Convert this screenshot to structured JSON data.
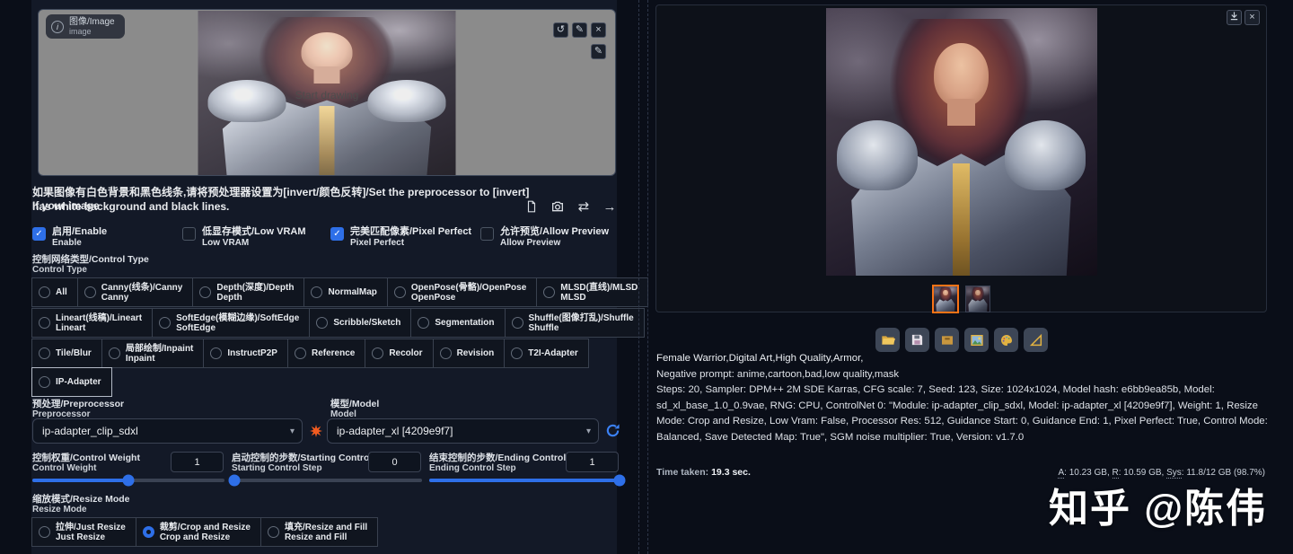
{
  "icons": {
    "caret": "▾",
    "check": "✓",
    "undo": "↺",
    "edit": "✎",
    "close": "×",
    "swap": "⇄",
    "arrow_right": "→",
    "info": "i"
  },
  "left": {
    "image_panel": {
      "label_line1": "图像/Image",
      "label_line2": "image",
      "start_drawing": "Start drawing"
    },
    "hint_line1": "如果图像有白色背景和黑色线条,请将预处理器设置为[invert/颜色反转]/Set the preprocessor to [invert] If your image",
    "hint_line2": "has white background and black lines.",
    "checkboxes": [
      {
        "l1": "启用/Enable",
        "l2": "Enable",
        "checked": true
      },
      {
        "l1": "低显存模式/Low VRAM",
        "l2": "Low VRAM",
        "checked": false
      },
      {
        "l1": "完美匹配像素/Pixel Perfect",
        "l2": "Pixel Perfect",
        "checked": true
      },
      {
        "l1": "允许预览/Allow Preview",
        "l2": "Allow Preview",
        "checked": false
      }
    ],
    "control_type_label1": "控制网络类型/Control Type",
    "control_type_label2": "Control Type",
    "control_types": {
      "row1": [
        {
          "l1": "All"
        },
        {
          "l1": "Canny(线条)/Canny",
          "l2": "Canny"
        },
        {
          "l1": "Depth(深度)/Depth",
          "l2": "Depth"
        },
        {
          "l1": "NormalMap"
        },
        {
          "l1": "OpenPose(骨骼)/OpenPose",
          "l2": "OpenPose"
        },
        {
          "l1": "MLSD(直线)/MLSD",
          "l2": "MLSD"
        }
      ],
      "row2": [
        {
          "l1": "Lineart(线稿)/Lineart",
          "l2": "Lineart"
        },
        {
          "l1": "SoftEdge(模糊边缘)/SoftEdge",
          "l2": "SoftEdge"
        },
        {
          "l1": "Scribble/Sketch"
        },
        {
          "l1": "Segmentation"
        },
        {
          "l1": "Shuffle(图像打乱)/Shuffle",
          "l2": "Shuffle"
        }
      ],
      "row3": [
        {
          "l1": "Tile/Blur"
        },
        {
          "l1": "局部绘制/Inpaint",
          "l2": "Inpaint"
        },
        {
          "l1": "InstructP2P"
        },
        {
          "l1": "Reference"
        },
        {
          "l1": "Recolor"
        },
        {
          "l1": "Revision"
        },
        {
          "l1": "T2I-Adapter"
        }
      ],
      "row4": [
        {
          "l1": "IP-Adapter",
          "selected": true
        }
      ]
    },
    "preprocessor": {
      "label1": "预处理/Preprocessor",
      "label2": "Preprocessor",
      "value": "ip-adapter_clip_sdxl"
    },
    "model": {
      "label1": "模型/Model",
      "label2": "Model",
      "value": "ip-adapter_xl [4209e9f7]"
    },
    "sliders": [
      {
        "l1": "控制权重/Control Weight",
        "l2": "Control Weight",
        "value": "1",
        "fill": 50
      },
      {
        "l1": "启动控制的步数/Starting Control Step",
        "l2": "Starting Control Step",
        "value": "0",
        "fill": 0
      },
      {
        "l1": "结束控制的步数/Ending Control Step",
        "l2": "Ending Control Step",
        "value": "1",
        "fill": 100
      }
    ],
    "resize": {
      "label1": "缩放模式/Resize Mode",
      "label2": "Resize Mode",
      "options": [
        {
          "l1": "拉伸/Just Resize",
          "l2": "Just Resize",
          "selected": false
        },
        {
          "l1": "裁剪/Crop and Resize",
          "l2": "Crop and Resize",
          "selected": true
        },
        {
          "l1": "填充/Resize and Fill",
          "l2": "Resize and Fill",
          "selected": false
        }
      ]
    }
  },
  "right": {
    "prompt": "Female Warrior,Digital Art,High Quality,Armor,",
    "negative": "Negative prompt: anime,cartoon,bad,low quality,mask",
    "params": "Steps: 20, Sampler: DPM++ 2M SDE Karras, CFG scale: 7, Seed: 123, Size: 1024x1024, Model hash: e6bb9ea85b, Model: sd_xl_base_1.0_0.9vae, RNG: CPU, ControlNet 0: \"Module: ip-adapter_clip_sdxl, Model: ip-adapter_xl [4209e9f7], Weight: 1, Resize Mode: Crop and Resize, Low Vram: False, Processor Res: 512, Guidance Start: 0, Guidance End: 1, Pixel Perfect: True, Control Mode: Balanced, Save Detected Map: True\", SGM noise multiplier: True, Version: v1.7.0",
    "time_label": "Time taken:",
    "time_value": "19.3 sec.",
    "memory": [
      {
        "label": "A",
        "rest": ": 10.23 GB, "
      },
      {
        "label": "R",
        "rest": ": 10.59 GB, "
      },
      {
        "label": "Sys",
        "rest": ": 11.8/12 GB (98.7%)"
      }
    ],
    "watermark": "知乎 @陈伟"
  }
}
